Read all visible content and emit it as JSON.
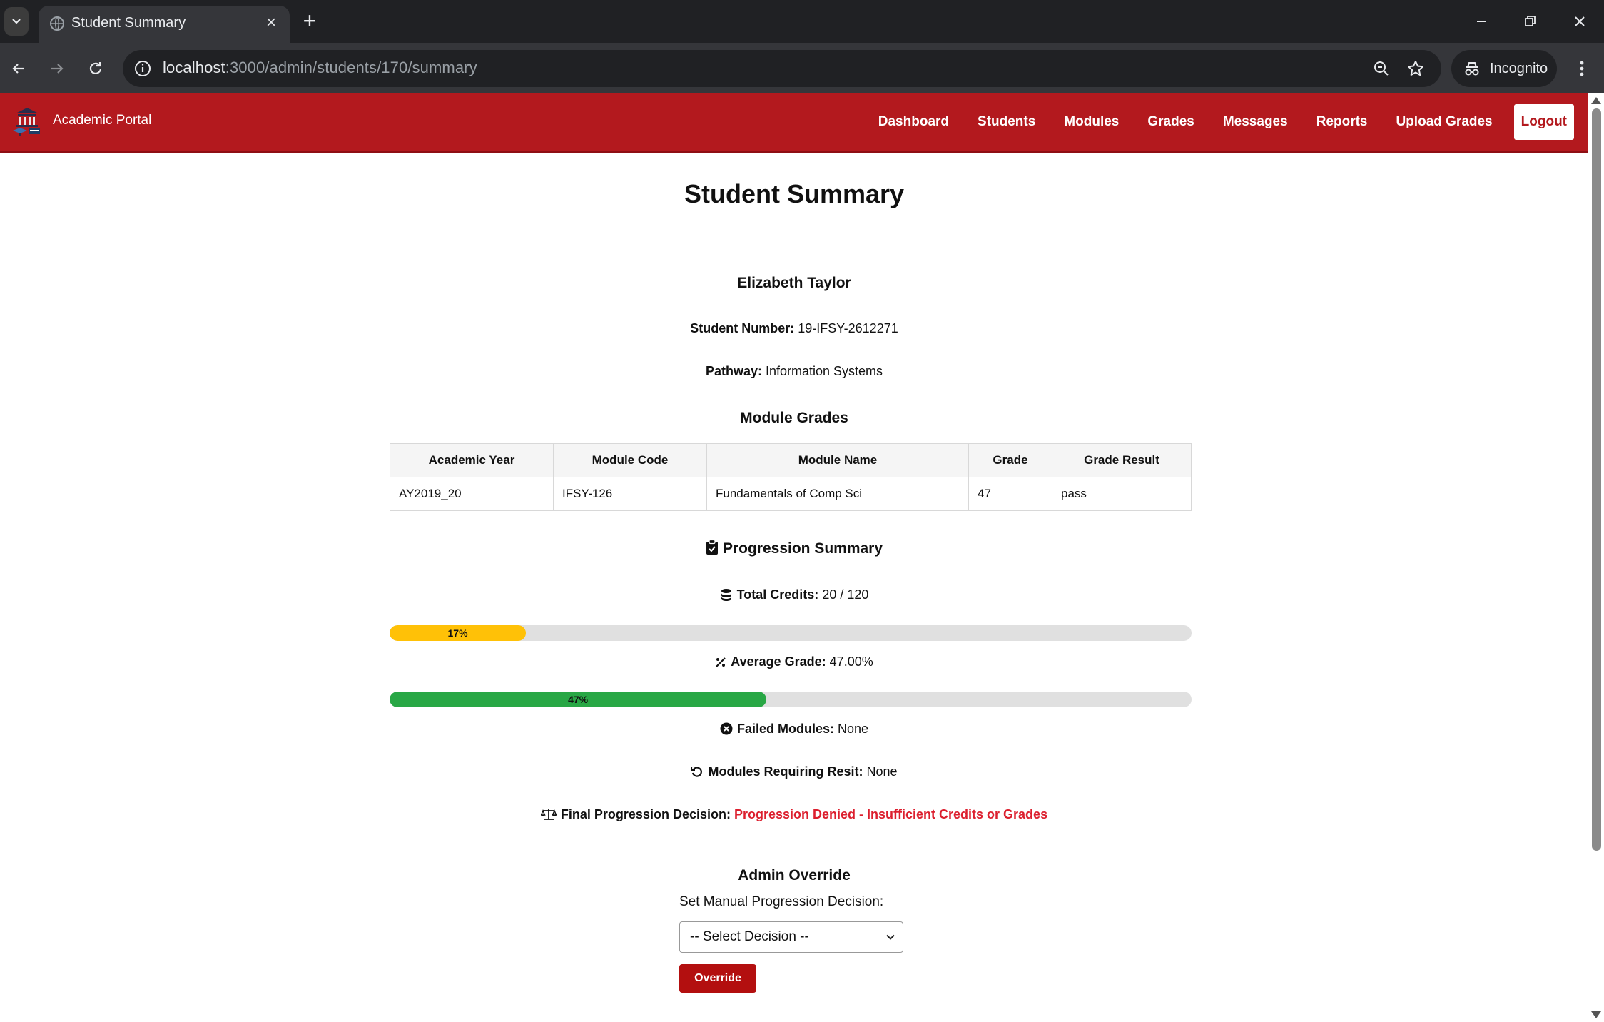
{
  "browser": {
    "tab_title": "Student Summary",
    "url_host": "localhost",
    "url_rest": ":3000/admin/students/170/summary",
    "incognito_label": "Incognito"
  },
  "navbar": {
    "brand": "Academic Portal",
    "links": [
      "Dashboard",
      "Students",
      "Modules",
      "Grades",
      "Messages",
      "Reports",
      "Upload Grades"
    ],
    "logout": "Logout",
    "bg_color": "#b3191e"
  },
  "page": {
    "title": "Student Summary",
    "student_name": "Elizabeth Taylor",
    "student_number_label": "Student Number:",
    "student_number": "19-IFSY-2612271",
    "pathway_label": "Pathway:",
    "pathway": "Information Systems"
  },
  "grades": {
    "heading": "Module Grades",
    "columns": [
      "Academic Year",
      "Module Code",
      "Module Name",
      "Grade",
      "Grade Result"
    ],
    "rows": [
      [
        "AY2019_20",
        "IFSY-126",
        "Fundamentals of Comp Sci",
        "47",
        "pass"
      ]
    ]
  },
  "progression": {
    "heading": "Progression Summary",
    "credits_label": "Total Credits:",
    "credits_value": "20 / 120",
    "credits_percent": 17,
    "credits_bar_label": "17%",
    "credits_bar_color": "#ffc107",
    "avg_label": "Average Grade:",
    "avg_value": "47.00%",
    "avg_percent": 47,
    "avg_bar_label": "47%",
    "avg_bar_color": "#28a745",
    "failed_label": "Failed Modules:",
    "failed_value": "None",
    "resit_label": "Modules Requiring Resit:",
    "resit_value": "None",
    "decision_label": "Final Progression Decision:",
    "decision_value": "Progression Denied - Insufficient Credits or Grades",
    "decision_color": "#dc1f2e"
  },
  "override": {
    "heading": "Admin Override",
    "label": "Set Manual Progression Decision:",
    "select_value": "-- Select Decision --",
    "button": "Override"
  }
}
